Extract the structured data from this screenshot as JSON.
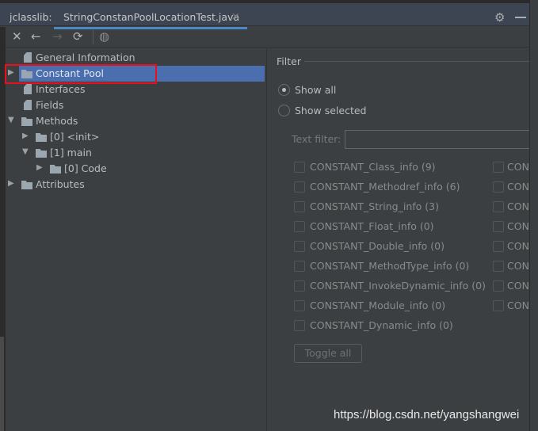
{
  "tabs": {
    "tool_label": "jclasslib:",
    "file": "StringConstanPoolLocationTest.java"
  },
  "toolbar": {
    "icons": [
      "close-icon",
      "back-icon",
      "forward-icon",
      "refresh-icon",
      "web-icon"
    ]
  },
  "tree": [
    {
      "label": "General Information",
      "icon": "file",
      "level": 0,
      "arrow": ""
    },
    {
      "label": "Constant Pool",
      "icon": "folder",
      "level": 0,
      "arrow": "collapsed",
      "selected": true
    },
    {
      "label": "Interfaces",
      "icon": "file",
      "level": 0,
      "arrow": ""
    },
    {
      "label": "Fields",
      "icon": "file",
      "level": 0,
      "arrow": ""
    },
    {
      "label": "Methods",
      "icon": "folder",
      "level": 0,
      "arrow": "expanded"
    },
    {
      "label": "[0] <init>",
      "icon": "folder",
      "level": 1,
      "arrow": "collapsed"
    },
    {
      "label": "[1] main",
      "icon": "folder",
      "level": 1,
      "arrow": "expanded"
    },
    {
      "label": "[0] Code",
      "icon": "folder",
      "level": 2,
      "arrow": "collapsed"
    },
    {
      "label": "Attributes",
      "icon": "folder",
      "level": 0,
      "arrow": "collapsed"
    }
  ],
  "filter": {
    "title": "Filter",
    "show_all": "Show all",
    "show_selected": "Show selected",
    "selected_mode": "show_all",
    "text_filter_label": "Text filter:",
    "text_filter_value": "",
    "col1": [
      "CONSTANT_Class_info (9)",
      "CONSTANT_Methodref_info (6)",
      "CONSTANT_String_info (3)",
      "CONSTANT_Float_info (0)",
      "CONSTANT_Double_info (0)",
      "CONSTANT_MethodType_info (0)",
      "CONSTANT_InvokeDynamic_info (0)",
      "CONSTANT_Module_info (0)",
      "CONSTANT_Dynamic_info (0)"
    ],
    "col2": [
      "CONS",
      "CONS",
      "CONS",
      "CONS",
      "CONS",
      "CONS",
      "CONS",
      "CONS"
    ],
    "toggle_all": "Toggle all"
  },
  "watermark": "https://blog.csdn.net/yangshangwei",
  "colors": {
    "background": "#3c3f41",
    "selection": "#4b6eaf",
    "tab_underline": "#4a88c7",
    "highlight_box": "#e8101a"
  }
}
